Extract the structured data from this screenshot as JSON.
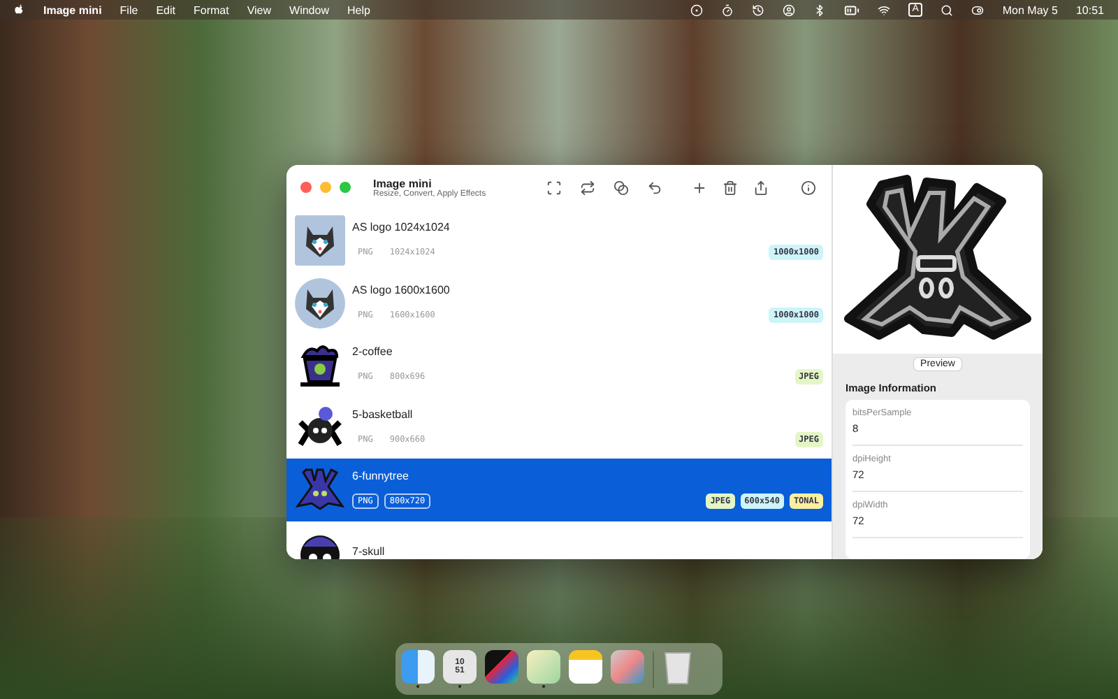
{
  "menu_bar": {
    "app_name": "Image mini",
    "menus": [
      "File",
      "Edit",
      "Format",
      "View",
      "Window",
      "Help"
    ],
    "input_source": "A",
    "date": "Mon May 5",
    "time": "10:51"
  },
  "window": {
    "title": "Image mini",
    "subtitle": "Resize, Convert, Apply Effects"
  },
  "files": [
    {
      "name": "AS logo 1024x1024",
      "kind": "dog-square",
      "format": "PNG",
      "size": "1024x1024",
      "selected": false,
      "tags": [
        {
          "label": "1000x1000",
          "color": "#cdf4f8"
        }
      ]
    },
    {
      "name": "AS logo 1600x1600",
      "kind": "dog-round",
      "format": "PNG",
      "size": "1600x1600",
      "selected": false,
      "tags": [
        {
          "label": "1000x1000",
          "color": "#cdf4f8"
        }
      ]
    },
    {
      "name": "2-coffee",
      "kind": "cup",
      "format": "PNG",
      "size": "800x696",
      "selected": false,
      "tags": [
        {
          "label": "JPEG",
          "color": "#e4f6c6"
        }
      ]
    },
    {
      "name": "5-basketball",
      "kind": "spider",
      "format": "PNG",
      "size": "900x660",
      "selected": false,
      "tags": [
        {
          "label": "JPEG",
          "color": "#e4f6c6"
        }
      ]
    },
    {
      "name": "6-funnytree",
      "kind": "tree",
      "format": "PNG",
      "size": "800x720",
      "selected": true,
      "tags": [
        {
          "label": "JPEG",
          "color": "#e4f6c6"
        },
        {
          "label": "600x540",
          "color": "#cdf4f8"
        },
        {
          "label": "TONAL",
          "color": "#fbf0a0"
        }
      ]
    },
    {
      "name": "7-skull",
      "kind": "skull",
      "selected": false
    }
  ],
  "inspector": {
    "preview_button": "Preview",
    "section_title": "Image Information",
    "fields": [
      {
        "key": "bitsPerSample",
        "value": "8"
      },
      {
        "key": "dpiHeight",
        "value": "72"
      },
      {
        "key": "dpiWidth",
        "value": "72"
      }
    ]
  },
  "dock": {
    "clock_hours": "10",
    "clock_minutes": "51",
    "apps": [
      {
        "kind": "finder",
        "running": true
      },
      {
        "kind": "clock",
        "running": true
      },
      {
        "kind": "photo-editor",
        "running": false
      },
      {
        "kind": "freeform",
        "running": true
      },
      {
        "kind": "notes",
        "running": false
      },
      {
        "kind": "iphone-mirroring",
        "running": false
      }
    ]
  }
}
